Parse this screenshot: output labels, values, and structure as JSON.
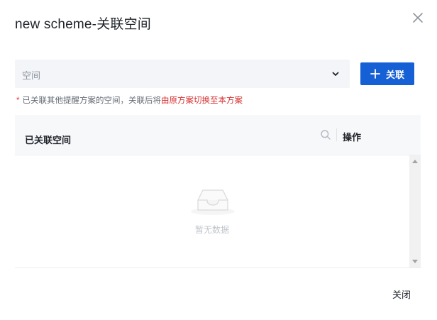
{
  "dialog": {
    "title": "new scheme-关联空间"
  },
  "space_select": {
    "placeholder": "空间"
  },
  "link_button": {
    "label": "关联"
  },
  "hint": {
    "star": "*",
    "text": "已关联其他提醒方案的空间，关联后将",
    "highlight": "由原方案切换至本方案"
  },
  "table": {
    "column_space": "已关联空间",
    "column_action": "操作",
    "empty_text": "暂无数据"
  },
  "footer": {
    "close_label": "关闭"
  },
  "colors": {
    "primary": "#1660d6",
    "danger": "#d72d2d",
    "muted": "#8f959e"
  },
  "icons": {
    "close": "close-icon",
    "arrow": "chevron-down-icon",
    "plus": "plus-icon",
    "search": "search-icon",
    "empty": "empty-inbox-icon"
  }
}
